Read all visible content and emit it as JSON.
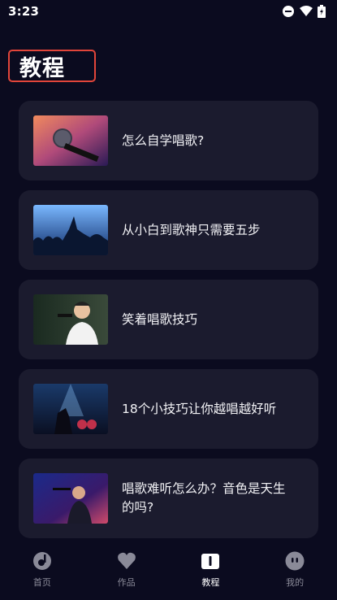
{
  "status": {
    "time": "3:23"
  },
  "page": {
    "title": "教程"
  },
  "tutorials": [
    {
      "title": "怎么自学唱歌?",
      "image": "microphone-photo"
    },
    {
      "title": "从小白到歌神只需要五步",
      "image": "concert-crowd-photo"
    },
    {
      "title": "笑着唱歌技巧",
      "image": "smiling-singer-photo"
    },
    {
      "title": "18个小技巧让你越唱越好听",
      "image": "band-stage-photo"
    },
    {
      "title": "唱歌难听怎么办？音色是天生的吗?",
      "image": "singer-stage-photo"
    }
  ],
  "tabs": [
    {
      "label": "首页",
      "icon": "music-disc-icon",
      "active": false
    },
    {
      "label": "作品",
      "icon": "heart-icon",
      "active": false
    },
    {
      "label": "教程",
      "icon": "book-icon",
      "active": true
    },
    {
      "label": "我的",
      "icon": "face-icon",
      "active": false
    }
  ],
  "colors": {
    "background": "#0b0b1f",
    "card": "#1b1b2e",
    "highlight": "#e2453a",
    "tab_inactive": "#8a8a98"
  }
}
